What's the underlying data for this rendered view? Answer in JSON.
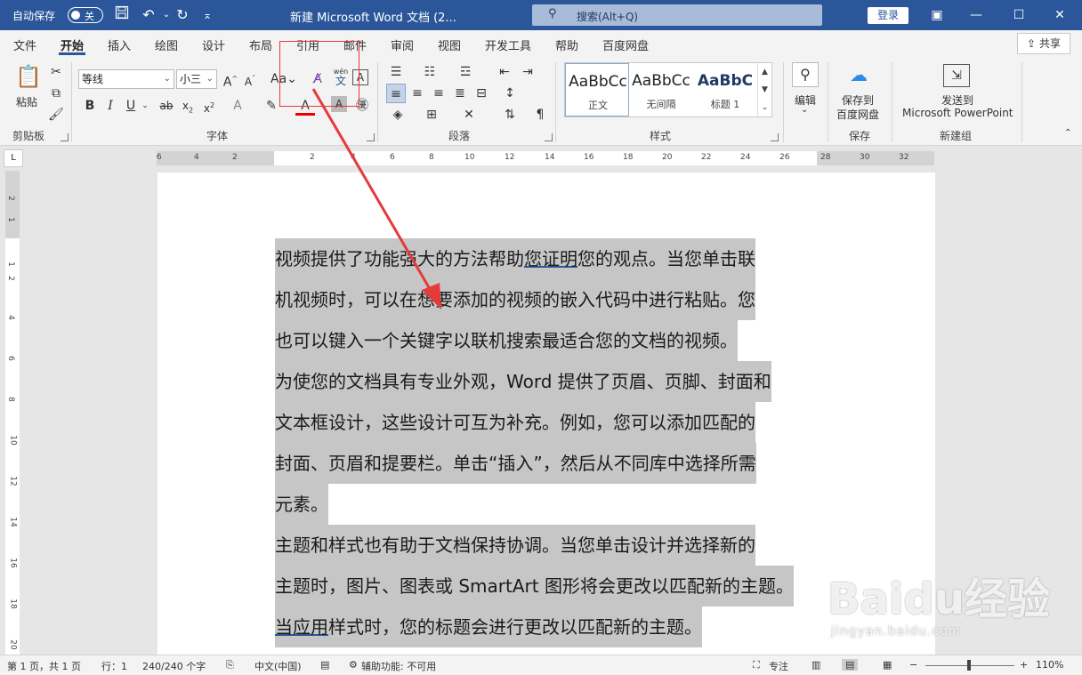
{
  "titlebar": {
    "autosave_label": "自动保存",
    "autosave_state": "关",
    "doc_title": "新建 Microsoft Word 文档 (2...",
    "search_placeholder": "搜索(Alt+Q)",
    "login_label": "登录"
  },
  "tabs": [
    "文件",
    "开始",
    "插入",
    "绘图",
    "设计",
    "布局",
    "引用",
    "邮件",
    "审阅",
    "视图",
    "开发工具",
    "帮助",
    "百度网盘"
  ],
  "share_label": "共享",
  "ribbon": {
    "clipboard": {
      "paste_label": "粘贴",
      "group_label": "剪贴板"
    },
    "font": {
      "font_name": "等线",
      "font_size": "小三",
      "group_label": "字体",
      "phonetic_top": "wén",
      "phonetic_bottom": "文"
    },
    "paragraph": {
      "group_label": "段落"
    },
    "styles": {
      "group_label": "样式",
      "items": [
        {
          "sample": "AaBbCc",
          "name": "正文"
        },
        {
          "sample": "AaBbCc",
          "name": "无间隔"
        },
        {
          "sample": "AaBbC",
          "name": "标题 1"
        }
      ]
    },
    "edit": {
      "label": "编辑"
    },
    "save": {
      "button_label_1": "保存到",
      "button_label_2": "百度网盘",
      "group_label": "保存"
    },
    "newgroup": {
      "button_label_1": "发送到",
      "button_label_2": "Microsoft PowerPoint",
      "group_label": "新建组"
    }
  },
  "ruler": {
    "h_numbers": [
      "6",
      "4",
      "2",
      "2",
      "4",
      "6",
      "8",
      "10",
      "12",
      "14",
      "16",
      "18",
      "20",
      "22",
      "24",
      "26",
      "28",
      "30",
      "32"
    ],
    "v_numbers": [
      "2",
      "1",
      "1",
      "2",
      "4",
      "6",
      "8",
      "10",
      "12",
      "14",
      "16",
      "18",
      "20"
    ]
  },
  "document": {
    "lines": [
      {
        "pre": "视频提供了功能强大的方法帮助",
        "u": "您证明",
        "post": "您的观点。当您单击联"
      },
      {
        "pre": "机视频时，可以在想要添加的视频的嵌入代码中进行粘贴。您",
        "u": "",
        "post": ""
      },
      {
        "pre": "也可以键入一个关键字以联机搜索最适合您的文档的视频。",
        "u": "",
        "post": ""
      },
      {
        "pre": "为使您的文档具有专业外观，Word 提供了页眉、页脚、封面和",
        "u": "",
        "post": ""
      },
      {
        "pre": "文本框设计，这些设计可互为补充。例如，您可以添加匹配的",
        "u": "",
        "post": ""
      },
      {
        "pre": "封面、页眉和提要栏。单击“插入”，然后从不同库中选择所需",
        "u": "",
        "post": ""
      },
      {
        "pre": "元素。",
        "u": "",
        "post": ""
      },
      {
        "pre": "主题和样式也有助于文档保持协调。当您单击设计并选择新的",
        "u": "",
        "post": ""
      },
      {
        "pre": "主题时，图片、图表或 SmartArt 图形将会更改以匹配新的主题。",
        "u": "",
        "post": ""
      },
      {
        "pre": "",
        "u": "当应用",
        "post": "样式时，您的标题会进行更改以匹配新的主题。"
      }
    ]
  },
  "statusbar": {
    "page": "第 1 页，共 1 页",
    "row": "行：1",
    "words": "240/240 个字",
    "lang": "中文(中国)",
    "accessibility": "辅助功能: 不可用",
    "focus": "专注",
    "zoom": "110%"
  },
  "watermark": {
    "brand": "Baidu经验",
    "url": "jingyan.baidu.com"
  },
  "colors": {
    "titlebar": "#2b579a",
    "selection": "#c6c6c6",
    "annotation": "#e53a3a"
  }
}
